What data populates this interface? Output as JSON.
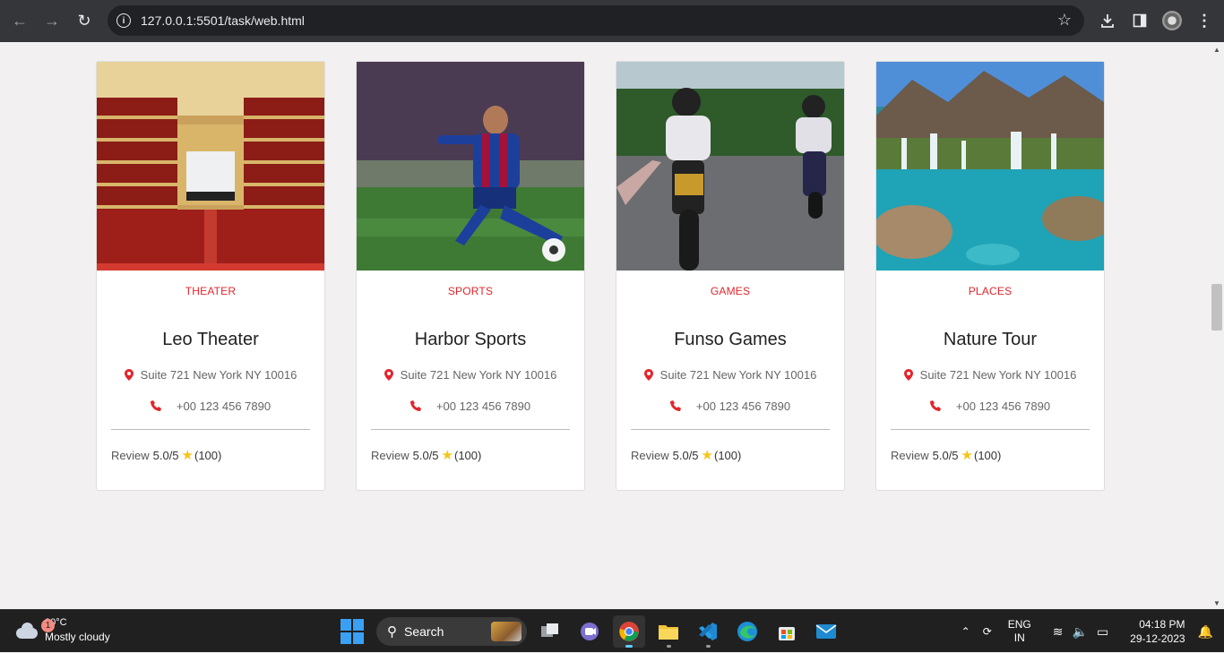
{
  "browser": {
    "url": "127.0.0.1:5501/task/web.html"
  },
  "cards": [
    {
      "category": "THEATER",
      "name": "Leo Theater",
      "address": "Suite 721 New York NY 10016",
      "phone": "+00 123 456 7890",
      "review_label": "Review",
      "review_score": "5.0/5",
      "review_count": "(100)"
    },
    {
      "category": "SPORTS",
      "name": "Harbor Sports",
      "address": "Suite 721 New York NY 10016",
      "phone": "+00 123 456 7890",
      "review_label": "Review",
      "review_score": "5.0/5",
      "review_count": "(100)"
    },
    {
      "category": "GAMES",
      "name": "Funso Games",
      "address": "Suite 721 New York NY 10016",
      "phone": "+00 123 456 7890",
      "review_label": "Review",
      "review_score": "5.0/5",
      "review_count": "(100)"
    },
    {
      "category": "PLACES",
      "name": "Nature Tour",
      "address": "Suite 721 New York NY 10016",
      "phone": "+00 123 456 7890",
      "review_label": "Review",
      "review_score": "5.0/5",
      "review_count": "(100)"
    }
  ],
  "taskbar": {
    "weather_badge": "1",
    "temperature": "30°C",
    "weather": "Mostly cloudy",
    "search_label": "Search",
    "lang_top": "ENG",
    "lang_bottom": "IN",
    "time": "04:18 PM",
    "date": "29-12-2023"
  },
  "colors": {
    "accent": "#e3252b",
    "star": "#f5c518"
  }
}
